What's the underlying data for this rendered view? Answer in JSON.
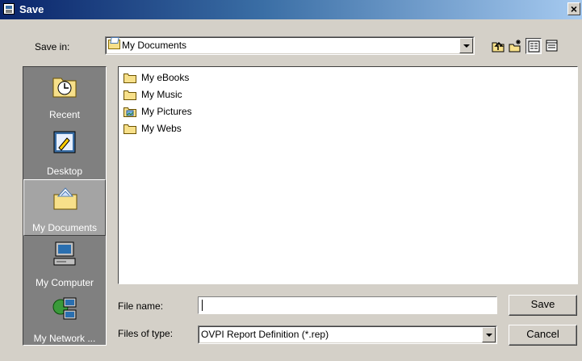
{
  "window": {
    "title": "Save"
  },
  "save_in": {
    "label": "Save in:",
    "value": "My Documents"
  },
  "toolbar": {
    "buttons": [
      "up-one-level-icon",
      "create-new-folder-icon",
      "list-view-icon",
      "details-view-icon"
    ]
  },
  "places": [
    {
      "label": "Recent",
      "icon": "recent-icon"
    },
    {
      "label": "Desktop",
      "icon": "desktop-icon"
    },
    {
      "label": "My Documents",
      "icon": "my-documents-icon",
      "selected": true
    },
    {
      "label": "My Computer",
      "icon": "my-computer-icon"
    },
    {
      "label": "My Network ...",
      "icon": "my-network-icon"
    }
  ],
  "files": [
    {
      "name": "My eBooks",
      "icon": "folder-icon"
    },
    {
      "name": "My Music",
      "icon": "folder-icon"
    },
    {
      "name": "My Pictures",
      "icon": "pictures-folder-icon"
    },
    {
      "name": "My Webs",
      "icon": "folder-icon"
    }
  ],
  "file_name": {
    "label": "File name:",
    "value": ""
  },
  "file_type": {
    "label": "Files of type:",
    "value": "OVPI Report Definition (*.rep)"
  },
  "buttons": {
    "save": "Save",
    "cancel": "Cancel"
  },
  "colors": {
    "title_bar": "#0a246a",
    "dialog_bg": "#d4d0c8",
    "places_bg": "#808080"
  }
}
